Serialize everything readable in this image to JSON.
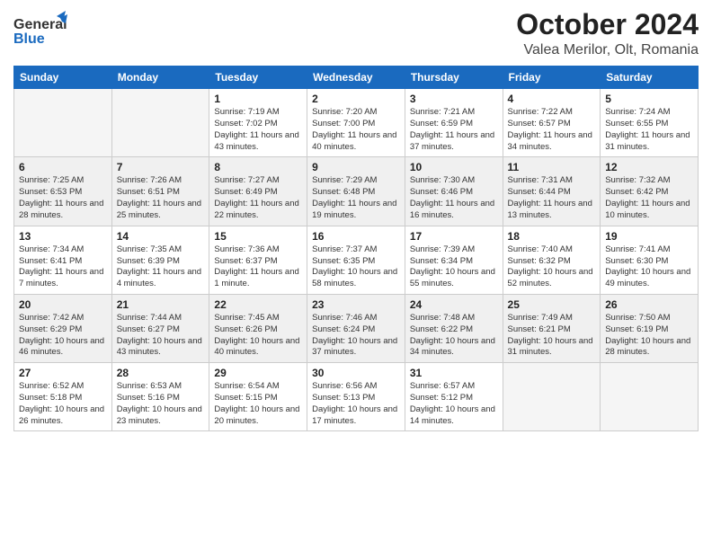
{
  "header": {
    "logo_general": "General",
    "logo_blue": "Blue",
    "title": "October 2024",
    "subtitle": "Valea Merilor, Olt, Romania"
  },
  "days_of_week": [
    "Sunday",
    "Monday",
    "Tuesday",
    "Wednesday",
    "Thursday",
    "Friday",
    "Saturday"
  ],
  "weeks": [
    {
      "cells": [
        {
          "day": "",
          "content": ""
        },
        {
          "day": "",
          "content": ""
        },
        {
          "day": "1",
          "content": "Sunrise: 7:19 AM\nSunset: 7:02 PM\nDaylight: 11 hours and 43 minutes."
        },
        {
          "day": "2",
          "content": "Sunrise: 7:20 AM\nSunset: 7:00 PM\nDaylight: 11 hours and 40 minutes."
        },
        {
          "day": "3",
          "content": "Sunrise: 7:21 AM\nSunset: 6:59 PM\nDaylight: 11 hours and 37 minutes."
        },
        {
          "day": "4",
          "content": "Sunrise: 7:22 AM\nSunset: 6:57 PM\nDaylight: 11 hours and 34 minutes."
        },
        {
          "day": "5",
          "content": "Sunrise: 7:24 AM\nSunset: 6:55 PM\nDaylight: 11 hours and 31 minutes."
        }
      ]
    },
    {
      "cells": [
        {
          "day": "6",
          "content": "Sunrise: 7:25 AM\nSunset: 6:53 PM\nDaylight: 11 hours and 28 minutes."
        },
        {
          "day": "7",
          "content": "Sunrise: 7:26 AM\nSunset: 6:51 PM\nDaylight: 11 hours and 25 minutes."
        },
        {
          "day": "8",
          "content": "Sunrise: 7:27 AM\nSunset: 6:49 PM\nDaylight: 11 hours and 22 minutes."
        },
        {
          "day": "9",
          "content": "Sunrise: 7:29 AM\nSunset: 6:48 PM\nDaylight: 11 hours and 19 minutes."
        },
        {
          "day": "10",
          "content": "Sunrise: 7:30 AM\nSunset: 6:46 PM\nDaylight: 11 hours and 16 minutes."
        },
        {
          "day": "11",
          "content": "Sunrise: 7:31 AM\nSunset: 6:44 PM\nDaylight: 11 hours and 13 minutes."
        },
        {
          "day": "12",
          "content": "Sunrise: 7:32 AM\nSunset: 6:42 PM\nDaylight: 11 hours and 10 minutes."
        }
      ]
    },
    {
      "cells": [
        {
          "day": "13",
          "content": "Sunrise: 7:34 AM\nSunset: 6:41 PM\nDaylight: 11 hours and 7 minutes."
        },
        {
          "day": "14",
          "content": "Sunrise: 7:35 AM\nSunset: 6:39 PM\nDaylight: 11 hours and 4 minutes."
        },
        {
          "day": "15",
          "content": "Sunrise: 7:36 AM\nSunset: 6:37 PM\nDaylight: 11 hours and 1 minute."
        },
        {
          "day": "16",
          "content": "Sunrise: 7:37 AM\nSunset: 6:35 PM\nDaylight: 10 hours and 58 minutes."
        },
        {
          "day": "17",
          "content": "Sunrise: 7:39 AM\nSunset: 6:34 PM\nDaylight: 10 hours and 55 minutes."
        },
        {
          "day": "18",
          "content": "Sunrise: 7:40 AM\nSunset: 6:32 PM\nDaylight: 10 hours and 52 minutes."
        },
        {
          "day": "19",
          "content": "Sunrise: 7:41 AM\nSunset: 6:30 PM\nDaylight: 10 hours and 49 minutes."
        }
      ]
    },
    {
      "cells": [
        {
          "day": "20",
          "content": "Sunrise: 7:42 AM\nSunset: 6:29 PM\nDaylight: 10 hours and 46 minutes."
        },
        {
          "day": "21",
          "content": "Sunrise: 7:44 AM\nSunset: 6:27 PM\nDaylight: 10 hours and 43 minutes."
        },
        {
          "day": "22",
          "content": "Sunrise: 7:45 AM\nSunset: 6:26 PM\nDaylight: 10 hours and 40 minutes."
        },
        {
          "day": "23",
          "content": "Sunrise: 7:46 AM\nSunset: 6:24 PM\nDaylight: 10 hours and 37 minutes."
        },
        {
          "day": "24",
          "content": "Sunrise: 7:48 AM\nSunset: 6:22 PM\nDaylight: 10 hours and 34 minutes."
        },
        {
          "day": "25",
          "content": "Sunrise: 7:49 AM\nSunset: 6:21 PM\nDaylight: 10 hours and 31 minutes."
        },
        {
          "day": "26",
          "content": "Sunrise: 7:50 AM\nSunset: 6:19 PM\nDaylight: 10 hours and 28 minutes."
        }
      ]
    },
    {
      "cells": [
        {
          "day": "27",
          "content": "Sunrise: 6:52 AM\nSunset: 5:18 PM\nDaylight: 10 hours and 26 minutes."
        },
        {
          "day": "28",
          "content": "Sunrise: 6:53 AM\nSunset: 5:16 PM\nDaylight: 10 hours and 23 minutes."
        },
        {
          "day": "29",
          "content": "Sunrise: 6:54 AM\nSunset: 5:15 PM\nDaylight: 10 hours and 20 minutes."
        },
        {
          "day": "30",
          "content": "Sunrise: 6:56 AM\nSunset: 5:13 PM\nDaylight: 10 hours and 17 minutes."
        },
        {
          "day": "31",
          "content": "Sunrise: 6:57 AM\nSunset: 5:12 PM\nDaylight: 10 hours and 14 minutes."
        },
        {
          "day": "",
          "content": ""
        },
        {
          "day": "",
          "content": ""
        }
      ]
    }
  ]
}
